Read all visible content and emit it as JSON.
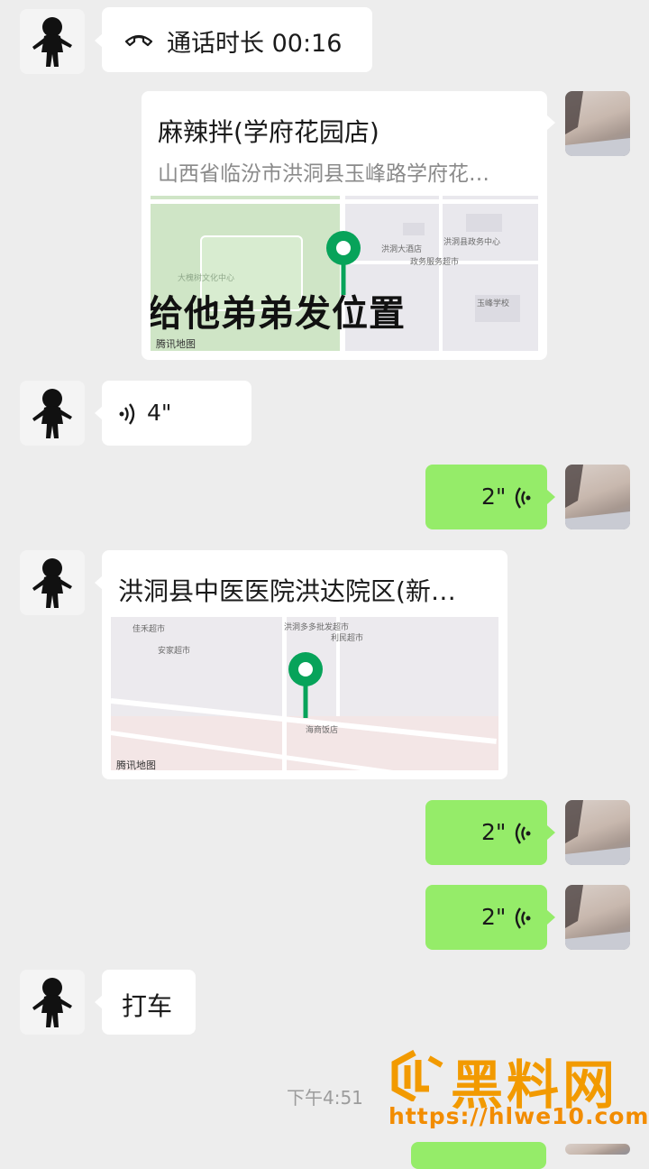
{
  "messages": {
    "call": {
      "text": "通话时长 00:16"
    },
    "location1": {
      "title": "麻辣拌(学府花园店)",
      "address": "山西省临汾市洪洞县玉峰路学府花…",
      "overlay": "给他弟弟发位置",
      "provider": "腾讯地图",
      "poi": [
        "洪洞县政务中心",
        "洪洞大酒店",
        "政务服务超市",
        "玉峰学校",
        "大槐树文化中心"
      ]
    },
    "voice1": {
      "duration": "4\""
    },
    "voice2": {
      "duration": "2\""
    },
    "location2": {
      "title": "洪洞县中医医院洪达院区(新…",
      "provider": "腾讯地图",
      "poi": [
        "佳禾超市",
        "洪洞多多批发超市",
        "利民超市",
        "安家超市",
        "海商饭店"
      ]
    },
    "voice3": {
      "duration": "2\""
    },
    "voice4": {
      "duration": "2\""
    },
    "text1": {
      "text": "打车"
    },
    "timestamp": "下午4:51"
  },
  "watermark": {
    "name": "黑料网",
    "url": "https://hlwe10.com"
  },
  "colors": {
    "background": "#ededed",
    "sent_bubble": "#95ec69",
    "received_bubble": "#ffffff",
    "pin": "#07a35a",
    "watermark": "#f29a00"
  }
}
